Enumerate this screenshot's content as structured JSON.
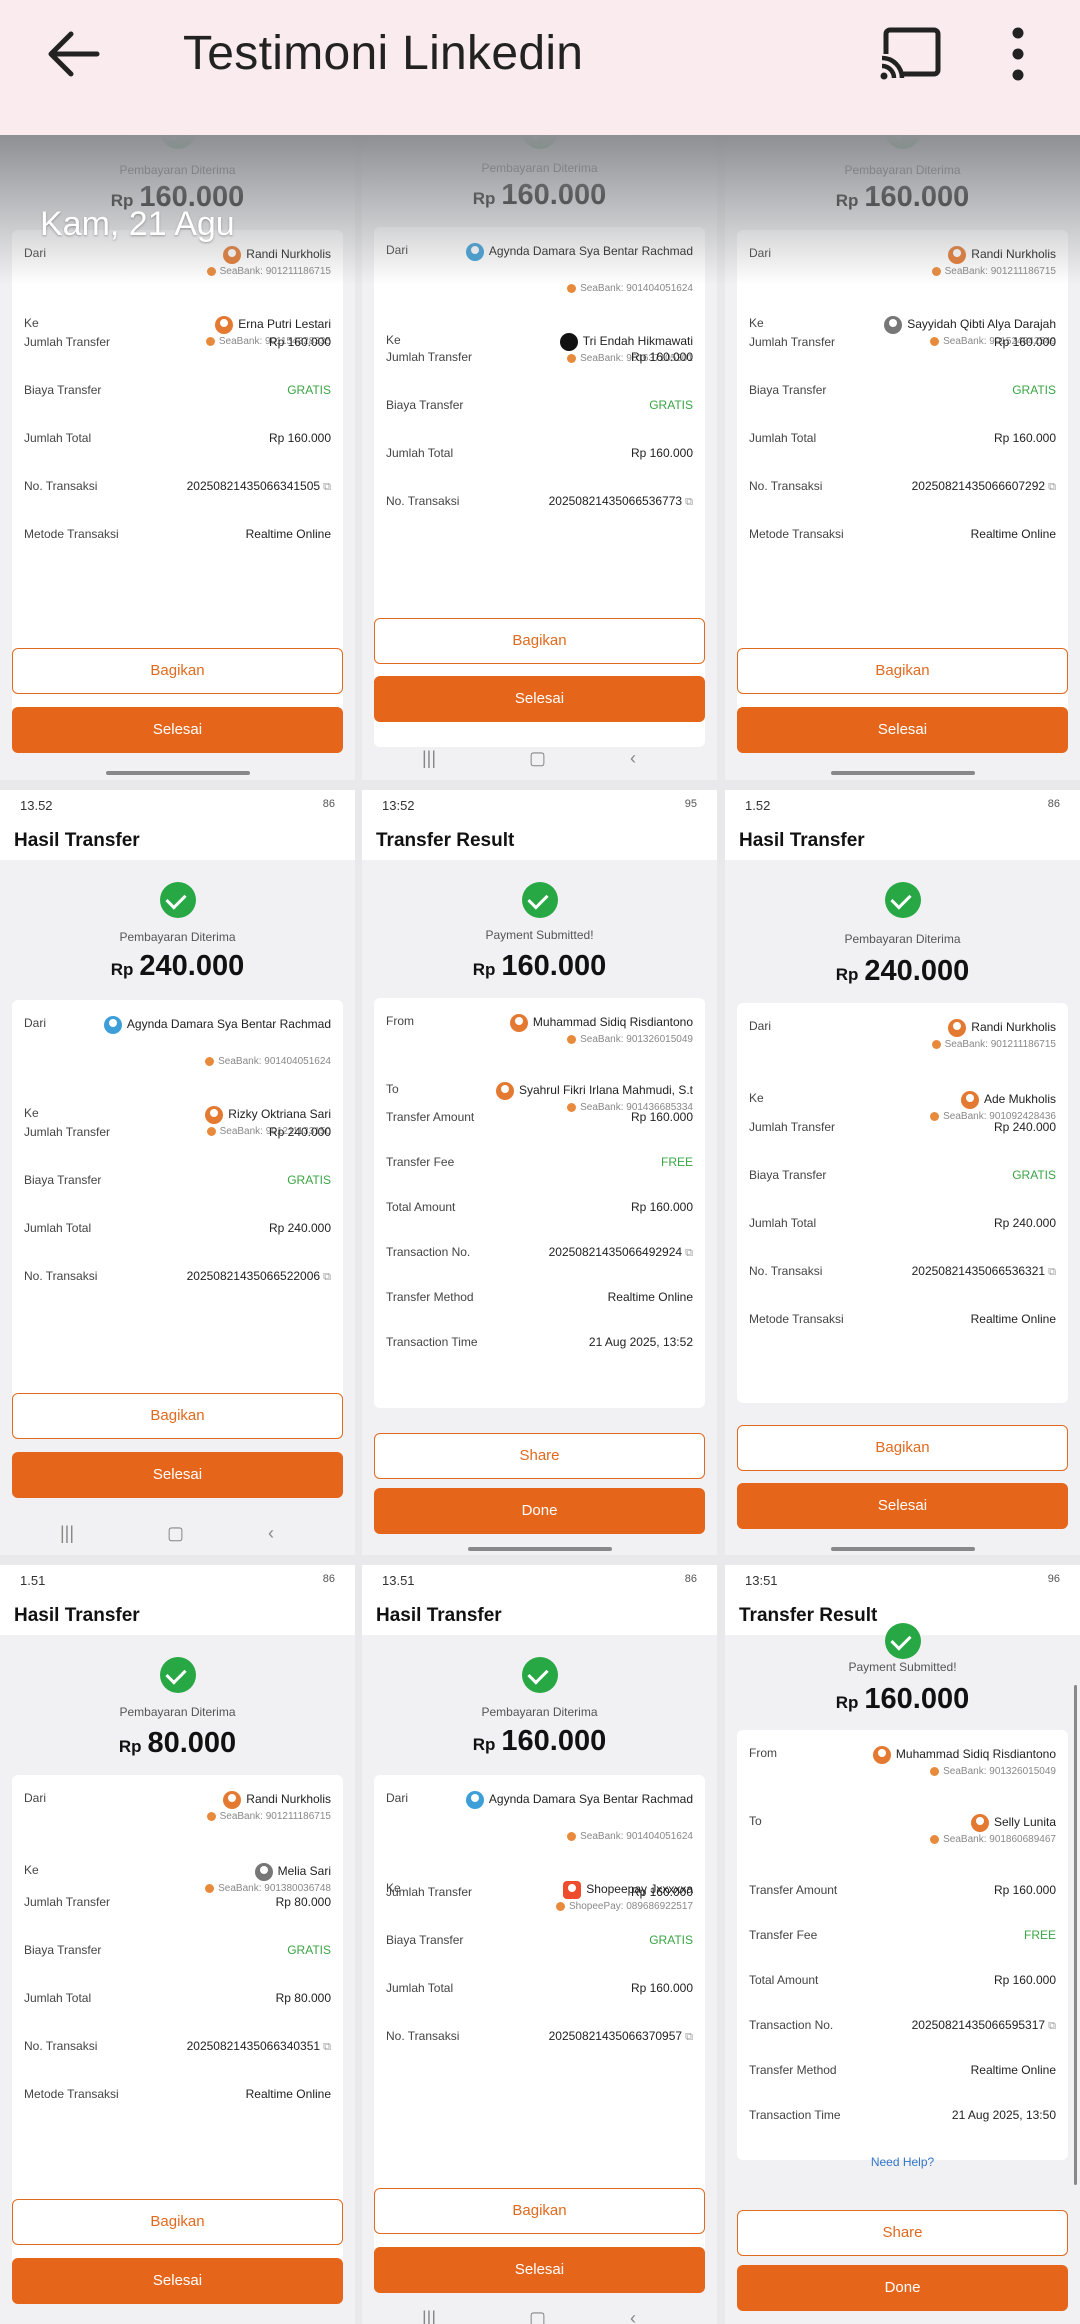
{
  "appbar": {
    "title": "Testimoni Linkedin",
    "back_icon": "arrow-back-icon",
    "cast_icon": "cast-icon",
    "more_icon": "more-vert-icon"
  },
  "date_chip": "Kam, 21 Agu",
  "screens": [
    {
      "status": "Pembayaran Diterima",
      "currency": "Rp",
      "amount": "160.000",
      "from_label": "Dari",
      "from_name": "Randi Nurkholis",
      "from_bank": "SeaBank: 901211186715",
      "to_label": "Ke",
      "to_name": "Erna Putri Lestari",
      "to_bank": "SeaBank: 901154328335",
      "rows": [
        {
          "l": "Jumlah Transfer",
          "v": "Rp 160.000"
        },
        {
          "l": "Biaya Transfer",
          "v": "GRATIS"
        },
        {
          "l": "Jumlah Total",
          "v": "Rp 160.000"
        },
        {
          "l": "No. Transaksi",
          "v": "20250821435066341505"
        },
        {
          "l": "Metode Transaksi",
          "v": "Realtime Online"
        }
      ],
      "share": "Bagikan",
      "done": "Selesai"
    },
    {
      "status": "Pembayaran Diterima",
      "currency": "Rp",
      "amount": "160.000",
      "from_label": "Dari",
      "from_name": "Agynda Damara Sya Bentar Rachmad",
      "from_bank": "SeaBank: 901404051624",
      "to_label": "Ke",
      "to_name": "Tri Endah Hikmawati",
      "to_bank": "SeaBank: 901637105301",
      "rows": [
        {
          "l": "Jumlah Transfer",
          "v": "Rp 160.000"
        },
        {
          "l": "Biaya Transfer",
          "v": "GRATIS"
        },
        {
          "l": "Jumlah Total",
          "v": "Rp 160.000"
        },
        {
          "l": "No. Transaksi",
          "v": "20250821435066536773"
        }
      ],
      "share": "Bagikan",
      "done": "Selesai"
    },
    {
      "status": "Pembayaran Diterima",
      "currency": "Rp",
      "amount": "160.000",
      "from_label": "Dari",
      "from_name": "Randi Nurkholis",
      "from_bank": "SeaBank: 901211186715",
      "to_label": "Ke",
      "to_name": "Sayyidah Qibti Alya Darajah",
      "to_bank": "SeaBank: 901524842549",
      "rows": [
        {
          "l": "Jumlah Transfer",
          "v": "Rp 160.000"
        },
        {
          "l": "Biaya Transfer",
          "v": "GRATIS"
        },
        {
          "l": "Jumlah Total",
          "v": "Rp 160.000"
        },
        {
          "l": "No. Transaksi",
          "v": "20250821435066607292"
        },
        {
          "l": "Metode Transaksi",
          "v": "Realtime Online"
        }
      ],
      "share": "Bagikan",
      "done": "Selesai"
    },
    {
      "time": "13.52",
      "battery": "86",
      "header": "Hasil Transfer",
      "status": "Pembayaran Diterima",
      "currency": "Rp",
      "amount": "240.000",
      "from_label": "Dari",
      "from_name": "Agynda Damara Sya Bentar Rachmad",
      "from_bank": "SeaBank: 901404051624",
      "to_label": "Ke",
      "to_name": "Rizky Oktriana Sari",
      "to_bank": "SeaBank: 901211133150",
      "rows": [
        {
          "l": "Jumlah Transfer",
          "v": "Rp 240.000"
        },
        {
          "l": "Biaya Transfer",
          "v": "GRATIS"
        },
        {
          "l": "Jumlah Total",
          "v": "Rp 240.000"
        },
        {
          "l": "No. Transaksi",
          "v": "20250821435066522006"
        }
      ],
      "share": "Bagikan",
      "done": "Selesai"
    },
    {
      "time": "13:52",
      "battery": "95",
      "header": "Transfer Result",
      "status": "Payment Submitted!",
      "currency": "Rp",
      "amount": "160.000",
      "from_label": "From",
      "from_name": "Muhammad Sidiq Risdiantono",
      "from_bank": "SeaBank: 901326015049",
      "to_label": "To",
      "to_name": "Syahrul Fikri Irlana Mahmudi, S.t",
      "to_bank": "SeaBank: 901436685334",
      "rows": [
        {
          "l": "Transfer Amount",
          "v": "Rp 160.000"
        },
        {
          "l": "Transfer Fee",
          "v": "FREE"
        },
        {
          "l": "Total Amount",
          "v": "Rp 160.000"
        },
        {
          "l": "Transaction No.",
          "v": "20250821435066492924"
        },
        {
          "l": "Transfer Method",
          "v": "Realtime Online"
        },
        {
          "l": "Transaction Time",
          "v": "21 Aug 2025, 13:52"
        }
      ],
      "share": "Share",
      "done": "Done"
    },
    {
      "time": "1.52",
      "battery": "86",
      "header": "Hasil Transfer",
      "status": "Pembayaran Diterima",
      "currency": "Rp",
      "amount": "240.000",
      "from_label": "Dari",
      "from_name": "Randi Nurkholis",
      "from_bank": "SeaBank: 901211186715",
      "to_label": "Ke",
      "to_name": "Ade Mukholis",
      "to_bank": "SeaBank: 901092428436",
      "rows": [
        {
          "l": "Jumlah Transfer",
          "v": "Rp 240.000"
        },
        {
          "l": "Biaya Transfer",
          "v": "GRATIS"
        },
        {
          "l": "Jumlah Total",
          "v": "Rp 240.000"
        },
        {
          "l": "No. Transaksi",
          "v": "20250821435066536321"
        },
        {
          "l": "Metode Transaksi",
          "v": "Realtime Online"
        }
      ],
      "share": "Bagikan",
      "done": "Selesai"
    },
    {
      "time": "1.51",
      "battery": "86",
      "header": "Hasil Transfer",
      "status": "Pembayaran Diterima",
      "currency": "Rp",
      "amount": "80.000",
      "from_label": "Dari",
      "from_name": "Randi Nurkholis",
      "from_bank": "SeaBank: 901211186715",
      "to_label": "Ke",
      "to_name": "Melia Sari",
      "to_bank": "SeaBank: 901380036748",
      "rows": [
        {
          "l": "Jumlah Transfer",
          "v": "Rp 80.000"
        },
        {
          "l": "Biaya Transfer",
          "v": "GRATIS"
        },
        {
          "l": "Jumlah Total",
          "v": "Rp 80.000"
        },
        {
          "l": "No. Transaksi",
          "v": "20250821435066340351"
        },
        {
          "l": "Metode Transaksi",
          "v": "Realtime Online"
        }
      ],
      "share": "Bagikan",
      "done": "Selesai"
    },
    {
      "time": "13.51",
      "battery": "86",
      "header": "Hasil Transfer",
      "status": "Pembayaran Diterima",
      "currency": "Rp",
      "amount": "160.000",
      "from_label": "Dari",
      "from_name": "Agynda Damara Sya Bentar Rachmad",
      "from_bank": "SeaBank: 901404051624",
      "to_label": "Ke",
      "to_name": "Shopeepay Jxxxxxa",
      "to_bank": "ShopeePay: 089686922517",
      "rows": [
        {
          "l": "Jumlah Transfer",
          "v": "Rp 160.000"
        },
        {
          "l": "Biaya Transfer",
          "v": "GRATIS"
        },
        {
          "l": "Jumlah Total",
          "v": "Rp 160.000"
        },
        {
          "l": "No. Transaksi",
          "v": "20250821435066370957"
        }
      ],
      "share": "Bagikan",
      "done": "Selesai"
    },
    {
      "time": "13:51",
      "battery": "96",
      "header": "Transfer Result",
      "status": "Payment Submitted!",
      "currency": "Rp",
      "amount": "160.000",
      "from_label": "From",
      "from_name": "Muhammad Sidiq Risdiantono",
      "from_bank": "SeaBank: 901326015049",
      "to_label": "To",
      "to_name": "Selly Lunita",
      "to_bank": "SeaBank: 901860689467",
      "rows": [
        {
          "l": "Transfer Amount",
          "v": "Rp 160.000"
        },
        {
          "l": "Transfer Fee",
          "v": "FREE"
        },
        {
          "l": "Total Amount",
          "v": "Rp 160.000"
        },
        {
          "l": "Transaction No.",
          "v": "20250821435066595317"
        },
        {
          "l": "Transfer Method",
          "v": "Realtime Online"
        },
        {
          "l": "Transaction Time",
          "v": "21 Aug 2025, 13:50"
        }
      ],
      "help": "Need Help?",
      "share": "Share",
      "done": "Done"
    }
  ]
}
